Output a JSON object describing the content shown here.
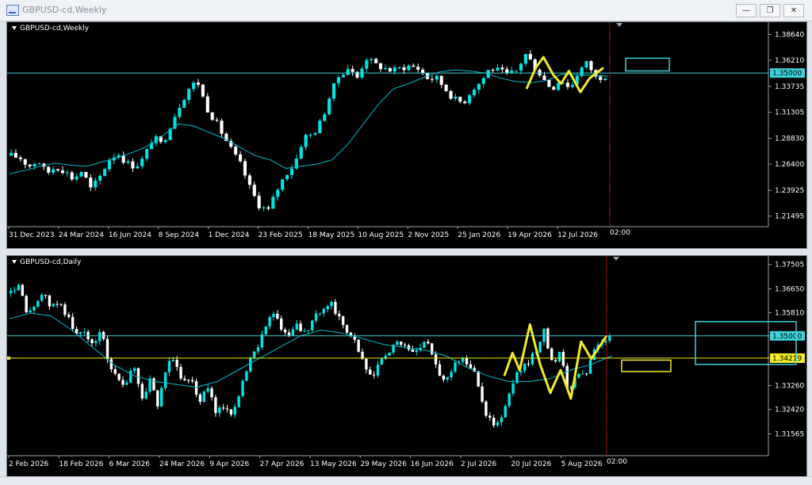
{
  "window": {
    "title": "GBPUSD-cd,Weekly",
    "minimize_icon": "minimize-icon",
    "restore_icon": "restore-icon",
    "close_icon": "close-icon"
  },
  "colors": {
    "background": "#000000",
    "bull": "#00e5e5",
    "bear": "#ffffff",
    "ma": "#00bcc8",
    "level_line": "#3fd0d8",
    "yellow": "#f2ea2a",
    "cursor_line": "#e21b1b"
  },
  "chart_data": [
    {
      "type": "candlestick",
      "symbol_label": "GBPUSD-cd,Weekly",
      "ylim": [
        1.205,
        1.398
      ],
      "y_ticks": [
        "1.38640",
        "1.36210",
        "1.33735",
        "1.31305",
        "1.28830",
        "1.26400",
        "1.23925",
        "1.21495"
      ],
      "x_ticks": [
        "31 Dec 2023",
        "24 Mar 2024",
        "16 Jun 2024",
        "8 Sep 2024",
        "1 Dec 2024",
        "23 Feb 2025",
        "18 May 2025",
        "10 Aug 2025",
        "2 Nov 2025",
        "25 Jan 2026",
        "19 Apr 2026",
        "12 Jul 2026"
      ],
      "close_path": [
        1.272,
        1.27,
        1.262,
        1.268,
        1.255,
        1.262,
        1.258,
        1.25,
        1.258,
        1.24,
        1.252,
        1.268,
        1.275,
        1.265,
        1.262,
        1.27,
        1.29,
        1.282,
        1.302,
        1.32,
        1.335,
        1.343,
        1.318,
        1.305,
        1.29,
        1.275,
        1.262,
        1.24,
        1.225,
        1.22,
        1.24,
        1.255,
        1.265,
        1.29,
        1.292,
        1.305,
        1.33,
        1.348,
        1.355,
        1.345,
        1.365,
        1.358,
        1.355,
        1.352,
        1.355,
        1.357,
        1.354,
        1.345,
        1.345,
        1.335,
        1.325,
        1.322,
        1.335,
        1.342,
        1.355,
        1.352,
        1.348,
        1.352,
        1.368,
        1.357,
        1.345,
        1.335,
        1.345,
        1.335,
        1.352,
        1.36,
        1.345,
        1.348
      ],
      "moving_average": [
        1.255,
        1.258,
        1.262,
        1.265,
        1.263,
        1.262,
        1.266,
        1.27,
        1.275,
        1.281,
        1.291,
        1.302,
        1.3,
        1.294,
        1.288,
        1.28,
        1.272,
        1.268,
        1.26,
        1.262,
        1.264,
        1.268,
        1.282,
        1.301,
        1.32,
        1.335,
        1.34,
        1.346,
        1.351,
        1.353,
        1.352,
        1.35,
        1.345,
        1.342,
        1.341,
        1.343,
        1.349,
        1.348,
        1.348,
        1.347
      ],
      "horizontal_line": 1.35,
      "horizontal_line_label": "1.35000",
      "cursor_time_label": "02:00",
      "zigzag": [
        [
          1.335,
          0
        ],
        [
          1.355,
          0.12
        ],
        [
          1.365,
          0.22
        ],
        [
          1.348,
          0.35
        ],
        [
          1.34,
          0.45
        ],
        [
          1.352,
          0.55
        ],
        [
          1.332,
          0.7
        ],
        [
          1.345,
          0.82
        ],
        [
          1.355,
          1.0
        ]
      ],
      "target_box": [
        1.352,
        1.364
      ]
    },
    {
      "type": "candlestick",
      "symbol_label": "GBPUSD-cd,Daily",
      "ylim": [
        1.308,
        1.378
      ],
      "y_ticks": [
        "1.37505",
        "1.36650",
        "1.35810",
        "1.35000",
        "1.34219",
        "1.33260",
        "1.32420",
        "1.31565"
      ],
      "x_ticks": [
        "2 Feb 2026",
        "18 Feb 2026",
        "6 Mar 2026",
        "24 Mar 2026",
        "9 Apr 2026",
        "27 Apr 2026",
        "13 May 2026",
        "29 May 2026",
        "16 Jun 2026",
        "2 Jul 2026",
        "20 Jul 2026",
        "5 Aug 2026"
      ],
      "close_path": [
        1.365,
        1.368,
        1.356,
        1.362,
        1.364,
        1.36,
        1.362,
        1.356,
        1.35,
        1.352,
        1.346,
        1.352,
        1.34,
        1.335,
        1.332,
        1.34,
        1.328,
        1.335,
        1.325,
        1.34,
        1.342,
        1.334,
        1.336,
        1.326,
        1.333,
        1.322,
        1.326,
        1.322,
        1.332,
        1.34,
        1.346,
        1.354,
        1.358,
        1.352,
        1.35,
        1.354,
        1.35,
        1.356,
        1.36,
        1.362,
        1.356,
        1.352,
        1.348,
        1.34,
        1.334,
        1.342,
        1.343,
        1.348,
        1.347,
        1.344,
        1.346,
        1.348,
        1.338,
        1.334,
        1.34,
        1.342,
        1.34,
        1.333,
        1.322,
        1.318,
        1.322,
        1.332,
        1.338,
        1.34,
        1.345,
        1.352,
        1.34,
        1.345,
        1.33,
        1.338,
        1.335,
        1.345,
        1.348,
        1.35
      ],
      "moving_average": [
        1.356,
        1.358,
        1.357,
        1.352,
        1.346,
        1.34,
        1.336,
        1.334,
        1.333,
        1.332,
        1.334,
        1.338,
        1.342,
        1.346,
        1.35,
        1.352,
        1.351,
        1.349,
        1.347,
        1.346,
        1.345,
        1.343,
        1.339,
        1.336,
        1.334,
        1.334,
        1.335,
        1.338,
        1.34,
        1.343
      ],
      "horizontal_line": 1.35,
      "horizontal_line_label": "1.35000",
      "secondary_line": 1.34219,
      "secondary_line_label": "1.34219",
      "cursor_time_label": "02:00",
      "zigzag": [
        [
          1.336,
          0
        ],
        [
          1.344,
          0.08
        ],
        [
          1.338,
          0.15
        ],
        [
          1.354,
          0.25
        ],
        [
          1.34,
          0.35
        ],
        [
          1.33,
          0.45
        ],
        [
          1.338,
          0.55
        ],
        [
          1.328,
          0.65
        ],
        [
          1.348,
          0.75
        ],
        [
          1.342,
          0.85
        ],
        [
          1.35,
          1.0
        ]
      ],
      "target_box": [
        1.34,
        1.355
      ],
      "target_box_lower": [
        1.3375,
        1.3415
      ]
    }
  ]
}
